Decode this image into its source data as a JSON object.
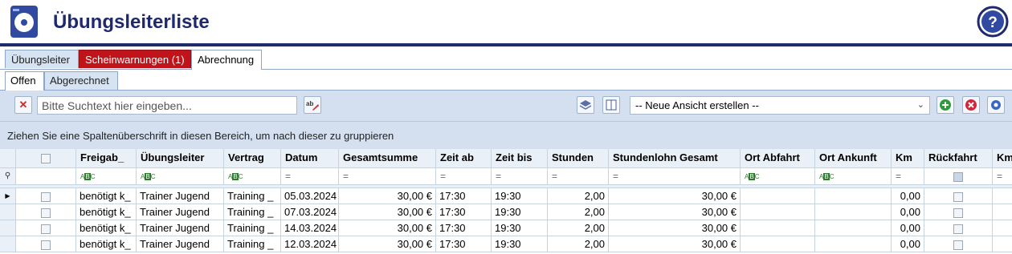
{
  "header": {
    "title": "Übungsleiterliste",
    "help_symbol": "?"
  },
  "tabs_main": [
    {
      "label": "Übungsleiter",
      "active": false
    },
    {
      "label": "Scheinwarnungen (1)",
      "active": false,
      "color": "#c0141a"
    },
    {
      "label": "Abrechnung",
      "active": true
    }
  ],
  "tabs_sub": [
    {
      "label": "Offen",
      "active": true
    },
    {
      "label": "Abgerechnet",
      "active": false
    }
  ],
  "toolbar": {
    "clear_icon": "close-x-icon",
    "search_placeholder": "Bitte Suchtext hier eingeben...",
    "search_value": "",
    "view_select_value": "-- Neue Ansicht erstellen --"
  },
  "groupbar": {
    "text": "Ziehen Sie eine Spaltenüberschrift in diesen Bereich, um nach dieser zu gruppieren"
  },
  "columns": [
    "Freigab_",
    "Übungsleiter",
    "Vertrag",
    "Datum",
    "Gesamtsumme",
    "Zeit ab",
    "Zeit bis",
    "Stunden",
    "Stundenlohn Gesamt",
    "Ort Abfahrt",
    "Ort Ankunft",
    "Km",
    "Rückfahrt",
    "Km"
  ],
  "filter_types": [
    "text",
    "text",
    "text",
    "equals",
    "equals",
    "equals",
    "equals",
    "equals",
    "equals",
    "text",
    "text",
    "equals",
    "check",
    "equals"
  ],
  "rows": [
    {
      "freigabe": "benötigt k_",
      "uebungsleiter": "Trainer Jugend",
      "vertrag": "Training _",
      "datum": "05.03.2024",
      "gesamtsumme": "30,00 €",
      "zeit_ab": "17:30",
      "zeit_bis": "19:30",
      "stunden": "2,00",
      "stundenlohn": "30,00 €",
      "km": "0,00",
      "current": true
    },
    {
      "freigabe": "benötigt k_",
      "uebungsleiter": "Trainer Jugend",
      "vertrag": "Training _",
      "datum": "07.03.2024",
      "gesamtsumme": "30,00 €",
      "zeit_ab": "17:30",
      "zeit_bis": "19:30",
      "stunden": "2,00",
      "stundenlohn": "30,00 €",
      "km": "0,00",
      "current": false
    },
    {
      "freigabe": "benötigt k_",
      "uebungsleiter": "Trainer Jugend",
      "vertrag": "Training _",
      "datum": "14.03.2024",
      "gesamtsumme": "30,00 €",
      "zeit_ab": "17:30",
      "zeit_bis": "19:30",
      "stunden": "2,00",
      "stundenlohn": "30,00 €",
      "km": "0,00",
      "current": false
    },
    {
      "freigabe": "benötigt k_",
      "uebungsleiter": "Trainer Jugend",
      "vertrag": "Training _",
      "datum": "12.03.2024",
      "gesamtsumme": "30,00 €",
      "zeit_ab": "17:30",
      "zeit_bis": "19:30",
      "stunden": "2,00",
      "stundenlohn": "30,00 €",
      "km": "0,00",
      "current": false
    }
  ],
  "colors": {
    "brand": "#1f2a6e",
    "warning_tab": "#c0141a",
    "toolbar_bg": "#d4e0ef"
  }
}
